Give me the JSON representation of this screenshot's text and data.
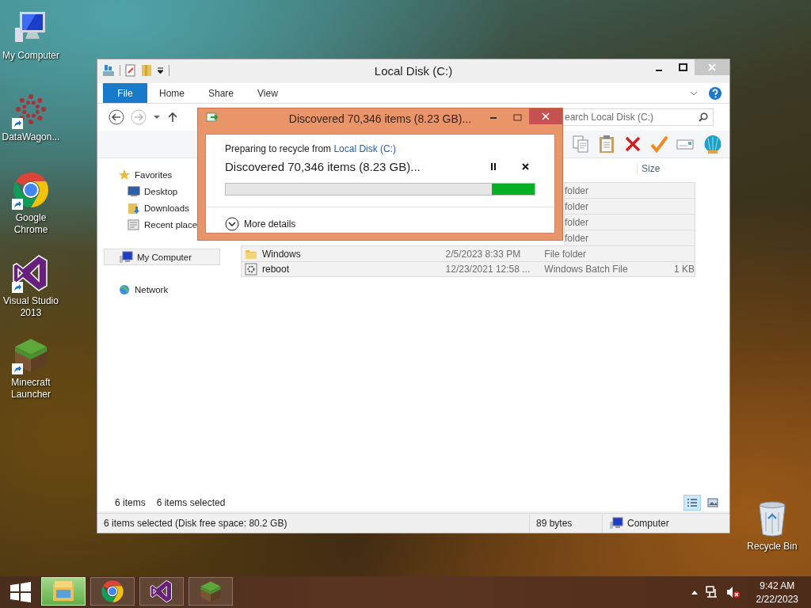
{
  "desktop_icons": [
    {
      "label": "My Computer",
      "kind": "computer",
      "shortcut": false
    },
    {
      "label": "DataWagon...",
      "kind": "datawagon",
      "shortcut": true
    },
    {
      "label": "Google Chrome",
      "kind": "chrome",
      "shortcut": true
    },
    {
      "label": "Visual Studio 2013",
      "kind": "vs",
      "shortcut": true
    },
    {
      "label": "Minecraft Launcher",
      "kind": "minecraft",
      "shortcut": true
    },
    {
      "label": "Recycle Bin",
      "kind": "recycle",
      "shortcut": false
    }
  ],
  "explorer": {
    "title": "Local Disk (C:)",
    "ribbon_tabs": [
      {
        "label": "File",
        "kind": "file"
      },
      {
        "label": "Home",
        "kind": "tab"
      },
      {
        "label": "Share",
        "kind": "tab"
      },
      {
        "label": "View",
        "kind": "tab"
      }
    ],
    "search": {
      "placeholder": "earch Local Disk (C:)"
    },
    "nav": [
      {
        "label": "Favorites",
        "kind": "star",
        "selected": false,
        "children": [
          {
            "label": "Desktop",
            "kind": "desktop",
            "selected": false
          },
          {
            "label": "Downloads",
            "kind": "downloads",
            "selected": false
          },
          {
            "label": "Recent place",
            "kind": "recent",
            "selected": false
          }
        ]
      },
      {
        "label": "My Computer",
        "kind": "computer",
        "selected": true
      },
      {
        "label": "Network",
        "kind": "network",
        "selected": false
      }
    ],
    "columns": [
      {
        "label": "Size"
      }
    ],
    "rows": [
      {
        "type": "folder",
        "selected": true
      },
      {
        "type": "folder",
        "selected": true
      },
      {
        "type": "folder",
        "selected": true
      },
      {
        "type": "folder",
        "selected": true
      },
      {
        "kind": "folder",
        "name": "Windows",
        "date": "2/5/2023 8:33 PM",
        "type": "File folder",
        "selected": true
      },
      {
        "kind": "batch",
        "name": "reboot",
        "date": "12/23/2021 12:58 ...",
        "type": "Windows Batch File",
        "size": "1 KB",
        "selected": true
      }
    ],
    "item_count": "6 items",
    "selection_count": "6 items selected",
    "views": [
      {
        "kind": "details",
        "selected": true
      },
      {
        "kind": "large",
        "selected": false
      }
    ],
    "status_bar": {
      "summary": "6 items selected (Disk free space: 80.2 GB)",
      "size": "89 bytes",
      "location": "Computer"
    }
  },
  "dialog": {
    "title": "Discovered 70,346 items (8.23 GB)...",
    "intro": "Preparing to recycle from ",
    "source_link": "Local Disk (C:)",
    "heading": "Discovered 70,346 items (8.23 GB)...",
    "details_toggle": "More details",
    "indeterminate": true,
    "expanded": false
  },
  "taskbar": {
    "apps": [
      {
        "kind": "explorer",
        "selected": true
      },
      {
        "kind": "chrome",
        "selected": false
      },
      {
        "kind": "vs",
        "selected": false
      },
      {
        "kind": "minecraft",
        "selected": false
      }
    ],
    "time": "9:42 AM",
    "date": "2/22/2023",
    "volume_muted": true
  }
}
